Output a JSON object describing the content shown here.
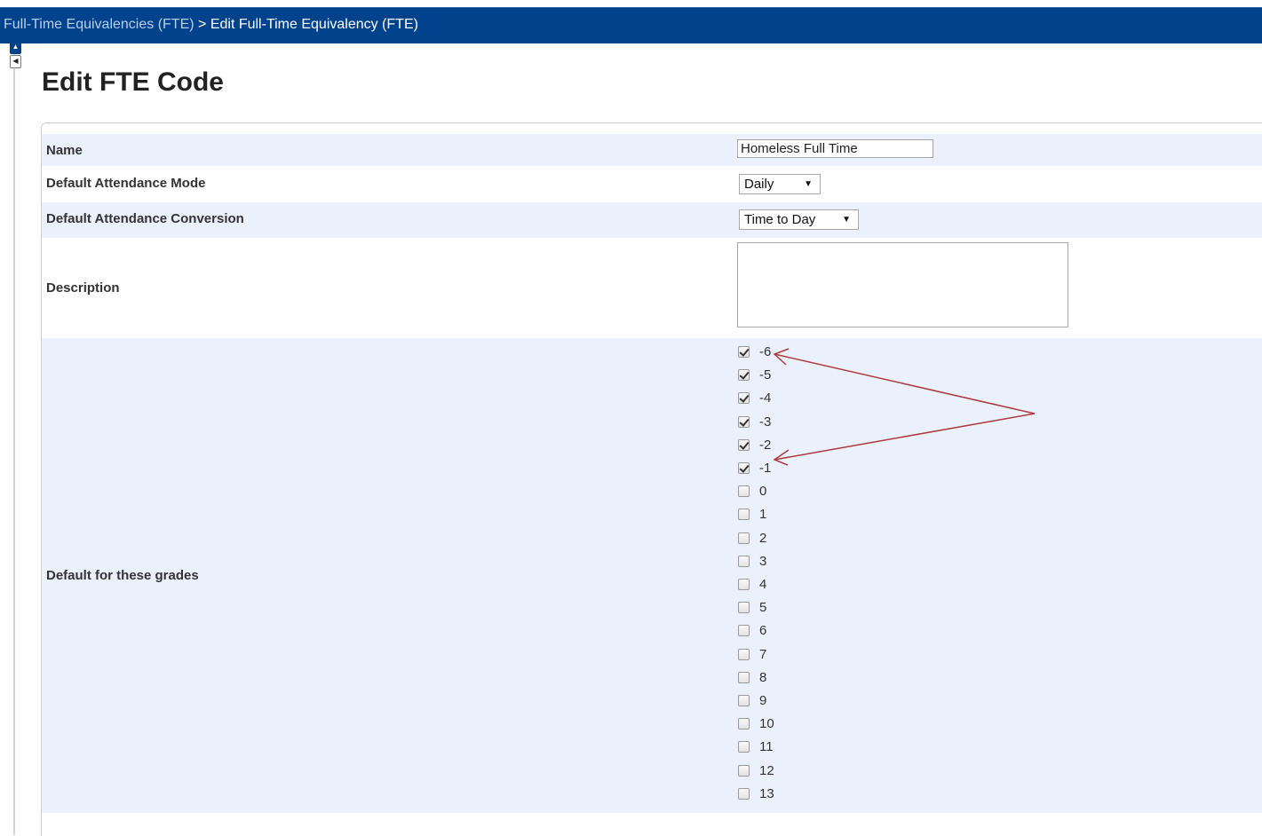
{
  "breadcrumb": {
    "parent": "Full-Time Equivalencies (FTE)",
    "separator": ">",
    "current": "Edit Full-Time Equivalency (FTE)"
  },
  "page": {
    "title": "Edit FTE Code"
  },
  "form": {
    "name_label": "Name",
    "name_value": "Homeless Full Time",
    "mode_label": "Default Attendance Mode",
    "mode_value": "Daily",
    "conversion_label": "Default Attendance Conversion",
    "conversion_value": "Time to Day",
    "description_label": "Description",
    "description_value": "",
    "grades_label": "Default for these grades",
    "grades": [
      {
        "label": "-6",
        "checked": true
      },
      {
        "label": "-5",
        "checked": true
      },
      {
        "label": "-4",
        "checked": true
      },
      {
        "label": "-3",
        "checked": true
      },
      {
        "label": "-2",
        "checked": true
      },
      {
        "label": "-1",
        "checked": true
      },
      {
        "label": "0",
        "checked": false
      },
      {
        "label": "1",
        "checked": false
      },
      {
        "label": "2",
        "checked": false
      },
      {
        "label": "3",
        "checked": false
      },
      {
        "label": "4",
        "checked": false
      },
      {
        "label": "5",
        "checked": false
      },
      {
        "label": "6",
        "checked": false
      },
      {
        "label": "7",
        "checked": false
      },
      {
        "label": "8",
        "checked": false
      },
      {
        "label": "9",
        "checked": false
      },
      {
        "label": "10",
        "checked": false
      },
      {
        "label": "11",
        "checked": false
      },
      {
        "label": "12",
        "checked": false
      },
      {
        "label": "13",
        "checked": false
      }
    ]
  },
  "colors": {
    "header_bg": "#00428c",
    "row_alt_bg": "#eaf1fd",
    "annotation": "#b03a3a"
  },
  "icons": {
    "rail_up": "triangle-up-icon",
    "rail_left": "triangle-left-icon",
    "select_caret": "caret-down-icon"
  }
}
